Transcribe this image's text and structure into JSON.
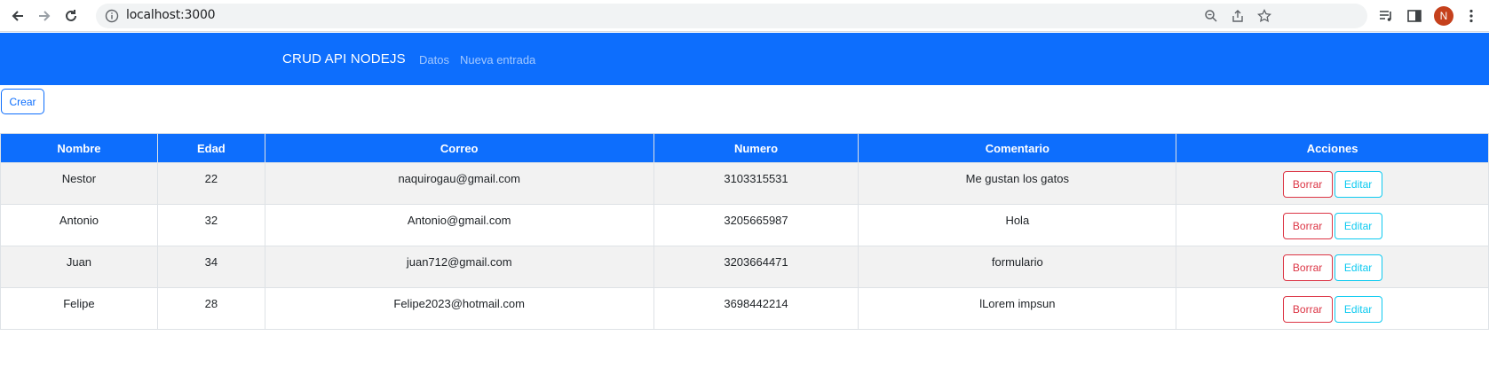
{
  "browser": {
    "url": "localhost:3000",
    "avatar_initial": "N",
    "icons": [
      "back-icon",
      "forward-icon",
      "reload-icon",
      "site-info-icon",
      "zoom-icon",
      "share-icon",
      "bookmark-star-icon",
      "media-queue-icon",
      "side-panel-icon",
      "menu-kebab-icon"
    ]
  },
  "navbar": {
    "brand": "CRUD API NODEJS",
    "links": [
      "Datos",
      "Nueva entrada"
    ]
  },
  "create_button": "Crear",
  "table": {
    "headers": [
      "Nombre",
      "Edad",
      "Correo",
      "Numero",
      "Comentario",
      "Acciones"
    ],
    "rows": [
      {
        "nombre": "Nestor",
        "edad": "22",
        "correo": "naquirogau@gmail.com",
        "numero": "3103315531",
        "comentario": "Me gustan los gatos"
      },
      {
        "nombre": "Antonio",
        "edad": "32",
        "correo": "Antonio@gmail.com",
        "numero": "3205665987",
        "comentario": "Hola"
      },
      {
        "nombre": "Juan",
        "edad": "34",
        "correo": "juan712@gmail.com",
        "numero": "3203664471",
        "comentario": "formulario"
      },
      {
        "nombre": "Felipe",
        "edad": "28",
        "correo": "Felipe2023@hotmail.com",
        "numero": "3698442214",
        "comentario": "lLorem impsun"
      }
    ],
    "delete_label": "Borrar",
    "edit_label": "Editar"
  },
  "colors": {
    "primary": "#0d6efd",
    "danger": "#dc3545",
    "info": "#0dcaf0",
    "avatar": "#c5401c"
  }
}
